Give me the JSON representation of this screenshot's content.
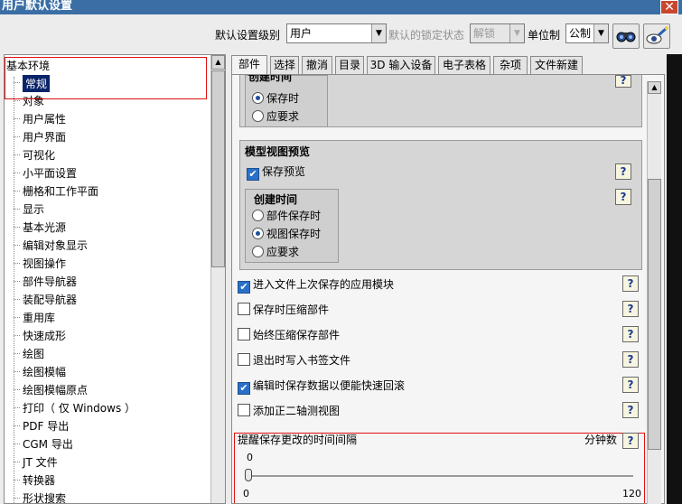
{
  "window": {
    "title": "用户默认设置",
    "close_label": "✕"
  },
  "toolbar": {
    "level_label": "默认设置级别",
    "level_value": "用户",
    "lock_label": "默认的锁定状态",
    "lock_value": "解锁",
    "unit_label": "单位制",
    "unit_value": "公制"
  },
  "tree": {
    "root": "基本环境",
    "selected_index": 0,
    "items": [
      "常规",
      "对象",
      "用户属性",
      "用户界面",
      "可视化",
      "小平面设置",
      "栅格和工作平面",
      "显示",
      "基本光源",
      "编辑对象显示",
      "视图操作",
      "部件导航器",
      "装配导航器",
      "重用库",
      "快速成形",
      "绘图",
      "绘图模幅",
      "绘图模幅原点",
      "打印（ 仅 Windows ）",
      "PDF 导出",
      "CGM 导出",
      "JT 文件",
      "转换器",
      "形状搜索"
    ]
  },
  "tabs": [
    "部件",
    "选择",
    "撤消",
    "目录",
    "3D 输入设备",
    "电子表格",
    "杂项",
    "文件新建"
  ],
  "active_tab": 0,
  "content": {
    "top_group": {
      "title": "创建时间",
      "options": [
        "保存时",
        "应要求"
      ],
      "selected": 0
    },
    "preview_group": {
      "title": "模型视图预览",
      "save_preview_label": "保存预览",
      "save_preview_checked": true,
      "sub_title": "创建时间",
      "options": [
        "部件保存时",
        "视图保存时",
        "应要求"
      ],
      "selected": 1
    },
    "checks": [
      {
        "label": "进入文件上次保存的应用模块",
        "checked": true
      },
      {
        "label": "保存时压缩部件",
        "checked": false
      },
      {
        "label": "始终压缩保存部件",
        "checked": false
      },
      {
        "label": "退出时写入书签文件",
        "checked": false
      },
      {
        "label": "编辑时保存数据以便能快速回滚",
        "checked": true
      },
      {
        "label": "添加正二轴测视图",
        "checked": false
      }
    ],
    "reminder": {
      "label": "提醒保存更改的时间间隔",
      "unit": "分钟数",
      "value": "0",
      "min": "0",
      "max": "120",
      "level": 0
    },
    "help_label": "?",
    "check_mark": "✔"
  }
}
